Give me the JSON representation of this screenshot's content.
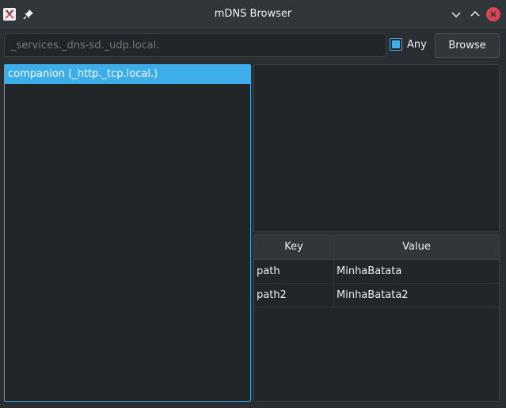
{
  "window": {
    "title": "mDNS Browser"
  },
  "toolbar": {
    "service_type_placeholder": "_services._dns-sd._udp.local.",
    "service_type_value": "",
    "any_label": "Any",
    "any_checked": true,
    "browse_label": "Browse"
  },
  "services": {
    "items": [
      {
        "label": "companion (_http._tcp.local.)",
        "selected": true
      }
    ]
  },
  "txt_records": {
    "columns": [
      "Key",
      "Value"
    ],
    "rows": [
      {
        "key": "path",
        "value": "MinhaBatata"
      },
      {
        "key": "path2",
        "value": "MinhaBatata2"
      }
    ]
  },
  "colors": {
    "accent": "#3daee9",
    "close": "#da4453",
    "background": "#2a2e32",
    "view_background": "#232629"
  },
  "icons": {
    "app": "app-icon",
    "pin": "pin-icon",
    "minimize": "chevron-down-icon",
    "maximize": "chevron-up-icon",
    "close": "close-icon"
  }
}
